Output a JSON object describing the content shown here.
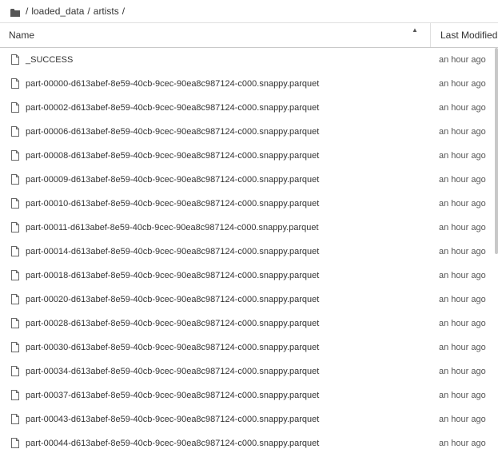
{
  "breadcrumb": {
    "icon": "folder-icon",
    "items": [
      "loaded_data",
      "artists"
    ]
  },
  "table": {
    "columns": {
      "name": "Name",
      "modified": "Last Modified"
    },
    "sort_icon": "sort-ascending-icon",
    "rows": [
      {
        "name": "_SUCCESS",
        "modified": "an hour ago",
        "icon": "file-icon"
      },
      {
        "name": "part-00000-d613abef-8e59-40cb-9cec-90ea8c987124-c000.snappy.parquet",
        "modified": "an hour ago",
        "icon": "file-icon"
      },
      {
        "name": "part-00002-d613abef-8e59-40cb-9cec-90ea8c987124-c000.snappy.parquet",
        "modified": "an hour ago",
        "icon": "file-icon"
      },
      {
        "name": "part-00006-d613abef-8e59-40cb-9cec-90ea8c987124-c000.snappy.parquet",
        "modified": "an hour ago",
        "icon": "file-icon"
      },
      {
        "name": "part-00008-d613abef-8e59-40cb-9cec-90ea8c987124-c000.snappy.parquet",
        "modified": "an hour ago",
        "icon": "file-icon"
      },
      {
        "name": "part-00009-d613abef-8e59-40cb-9cec-90ea8c987124-c000.snappy.parquet",
        "modified": "an hour ago",
        "icon": "file-icon"
      },
      {
        "name": "part-00010-d613abef-8e59-40cb-9cec-90ea8c987124-c000.snappy.parquet",
        "modified": "an hour ago",
        "icon": "file-icon"
      },
      {
        "name": "part-00011-d613abef-8e59-40cb-9cec-90ea8c987124-c000.snappy.parquet",
        "modified": "an hour ago",
        "icon": "file-icon"
      },
      {
        "name": "part-00014-d613abef-8e59-40cb-9cec-90ea8c987124-c000.snappy.parquet",
        "modified": "an hour ago",
        "icon": "file-icon"
      },
      {
        "name": "part-00018-d613abef-8e59-40cb-9cec-90ea8c987124-c000.snappy.parquet",
        "modified": "an hour ago",
        "icon": "file-icon"
      },
      {
        "name": "part-00020-d613abef-8e59-40cb-9cec-90ea8c987124-c000.snappy.parquet",
        "modified": "an hour ago",
        "icon": "file-icon"
      },
      {
        "name": "part-00028-d613abef-8e59-40cb-9cec-90ea8c987124-c000.snappy.parquet",
        "modified": "an hour ago",
        "icon": "file-icon"
      },
      {
        "name": "part-00030-d613abef-8e59-40cb-9cec-90ea8c987124-c000.snappy.parquet",
        "modified": "an hour ago",
        "icon": "file-icon"
      },
      {
        "name": "part-00034-d613abef-8e59-40cb-9cec-90ea8c987124-c000.snappy.parquet",
        "modified": "an hour ago",
        "icon": "file-icon"
      },
      {
        "name": "part-00037-d613abef-8e59-40cb-9cec-90ea8c987124-c000.snappy.parquet",
        "modified": "an hour ago",
        "icon": "file-icon"
      },
      {
        "name": "part-00043-d613abef-8e59-40cb-9cec-90ea8c987124-c000.snappy.parquet",
        "modified": "an hour ago",
        "icon": "file-icon"
      },
      {
        "name": "part-00044-d613abef-8e59-40cb-9cec-90ea8c987124-c000.snappy.parquet",
        "modified": "an hour ago",
        "icon": "file-icon"
      }
    ]
  }
}
